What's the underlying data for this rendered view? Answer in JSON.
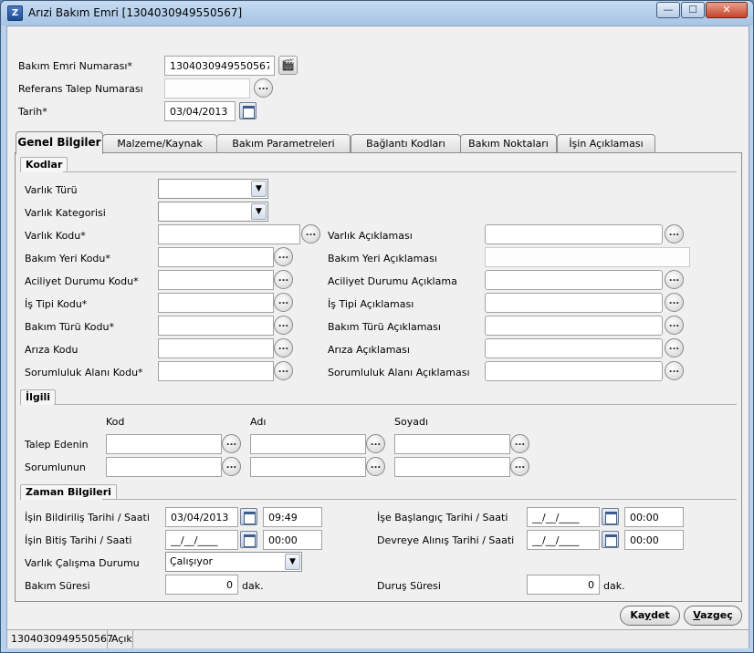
{
  "window": {
    "title": "Arızi Bakım Emri [1304030949550567]",
    "icon_label": "Z",
    "controls": {
      "minimize": "—",
      "maximize": "☐",
      "close": "✕"
    }
  },
  "header": {
    "order_no_label": "Bakım Emri Numarası*",
    "order_no_value": "1304030949550567",
    "ref_label": "Referans Talep Numarası",
    "ref_value": "",
    "date_label": "Tarih*",
    "date_value": "03/04/2013"
  },
  "tabs": [
    {
      "label": "Genel Bilgiler",
      "active": true
    },
    {
      "label": "Malzeme/Kaynak"
    },
    {
      "label": "Bakım Parametreleri"
    },
    {
      "label": "Bağlantı Kodları"
    },
    {
      "label": "Bakım Noktaları"
    },
    {
      "label": "İşin Açıklaması"
    }
  ],
  "kodlar": {
    "title": "Kodlar",
    "asset_type_label": "Varlık Türü",
    "asset_type_value": "",
    "asset_category_label": "Varlık Kategorisi",
    "asset_category_value": "",
    "rows": [
      {
        "code_label": "Varlık Kodu*",
        "desc_label": "Varlık Açıklaması"
      },
      {
        "code_label": "Bakım Yeri Kodu*",
        "desc_label": "Bakım Yeri Açıklaması"
      },
      {
        "code_label": "Aciliyet Durumu Kodu*",
        "desc_label": "Aciliyet Durumu Açıklama"
      },
      {
        "code_label": "İş Tipi Kodu*",
        "desc_label": "İş Tipi Açıklaması"
      },
      {
        "code_label": "Bakım Türü Kodu*",
        "desc_label": "Bakım Türü Açıklaması"
      },
      {
        "code_label": "Arıza Kodu",
        "desc_label": "Arıza Açıklaması"
      },
      {
        "code_label": "Sorumluluk Alanı Kodu*",
        "desc_label": "Sorumluluk Alanı Açıklaması"
      }
    ]
  },
  "ilgili": {
    "title": "İlgili",
    "col_code": "Kod",
    "col_name": "Adı",
    "col_surname": "Soyadı",
    "requester_label": "Talep Edenin",
    "responsible_label": "Sorumlunun"
  },
  "zaman": {
    "title": "Zaman Bilgileri",
    "notify_label": "İşin Bildiriliş Tarihi / Saati",
    "notify_date": "03/04/2013",
    "notify_time": "09:49",
    "end_label": "İşin Bitiş Tarihi / Saati",
    "end_date": "__/__/____",
    "end_time": "00:00",
    "start_label": "İşe Başlangıç Tarihi / Saati",
    "start_date": "__/__/____",
    "start_time": "00:00",
    "commission_label": "Devreye Alınış Tarihi / Saati",
    "commission_date": "__/__/____",
    "commission_time": "00:00",
    "asset_status_label": "Varlık Çalışma Durumu",
    "asset_status_value": "Çalışıyor",
    "maint_duration_label": "Bakım Süresi",
    "maint_duration_value": "0",
    "downtime_label": "Duruş Süresi",
    "downtime_value": "0",
    "unit": "dak."
  },
  "buttons": {
    "save_pre": "Ka",
    "save_ul": "y",
    "save_post": "det",
    "cancel_ul": "V",
    "cancel_post": "azgeç"
  },
  "status": {
    "order_no": "1304030949550567",
    "state": "Açık"
  },
  "icons": {
    "ellipsis": "...",
    "dropdown": "chevron-down-icon",
    "calendar": "calendar-icon",
    "clapper": "clapperboard-icon"
  }
}
